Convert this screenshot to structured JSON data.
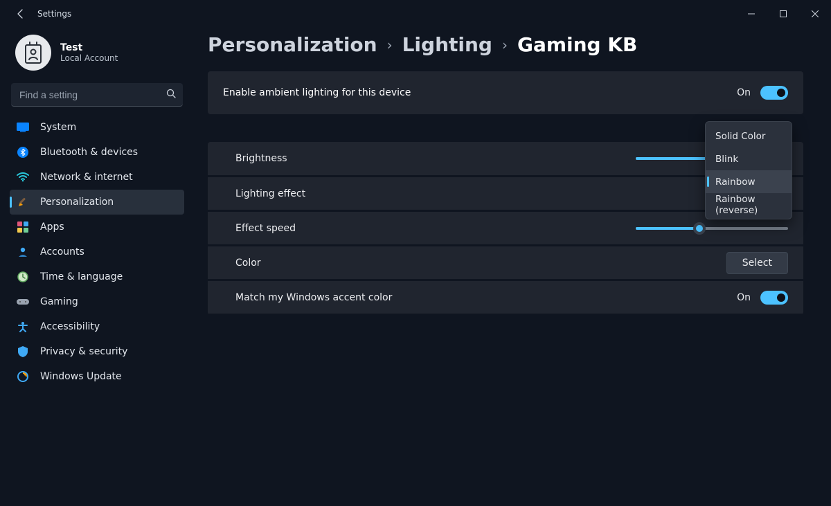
{
  "window": {
    "title": "Settings"
  },
  "profile": {
    "name": "Test",
    "subtitle": "Local Account"
  },
  "search": {
    "placeholder": "Find a setting"
  },
  "sidebar": {
    "items": [
      {
        "id": "system",
        "label": "System"
      },
      {
        "id": "bluetooth",
        "label": "Bluetooth & devices"
      },
      {
        "id": "network",
        "label": "Network & internet"
      },
      {
        "id": "personalization",
        "label": "Personalization",
        "active": true
      },
      {
        "id": "apps",
        "label": "Apps"
      },
      {
        "id": "accounts",
        "label": "Accounts"
      },
      {
        "id": "time",
        "label": "Time & language"
      },
      {
        "id": "gaming",
        "label": "Gaming"
      },
      {
        "id": "accessibility",
        "label": "Accessibility"
      },
      {
        "id": "privacy",
        "label": "Privacy & security"
      },
      {
        "id": "update",
        "label": "Windows Update"
      }
    ]
  },
  "breadcrumbs": {
    "level1": "Personalization",
    "level2": "Lighting",
    "level3": "Gaming KB"
  },
  "settings": {
    "enable": {
      "label": "Enable ambient lighting for this device",
      "state_label": "On",
      "value": true
    },
    "brightness": {
      "label": "Brightness",
      "value": 78
    },
    "lighting_effect": {
      "label": "Lighting effect",
      "selected": "Rainbow"
    },
    "effect_speed": {
      "label": "Effect speed",
      "value": 42
    },
    "color": {
      "label": "Color",
      "button": "Select"
    },
    "match_accent": {
      "label": "Match my Windows accent color",
      "state_label": "On",
      "value": true
    },
    "effect_options": [
      {
        "label": "Solid Color"
      },
      {
        "label": "Blink"
      },
      {
        "label": "Rainbow",
        "selected": true
      },
      {
        "label": "Rainbow (reverse)"
      }
    ]
  },
  "colors": {
    "accent": "#4cc2ff"
  }
}
